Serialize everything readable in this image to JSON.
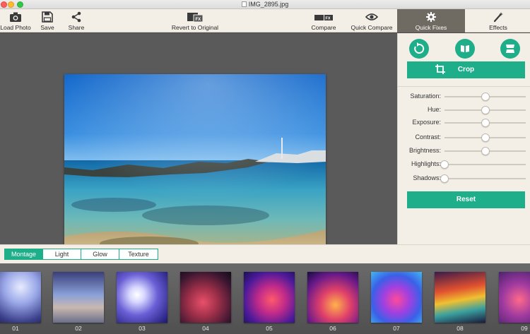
{
  "window": {
    "title": "IMG_2895.jpg"
  },
  "toolbar": {
    "load_photo": "Load Photo",
    "save": "Save",
    "share": "Share",
    "revert": "Revert to Original",
    "compare": "Compare",
    "quick_compare": "Quick Compare",
    "quick_fixes": "Quick Fixes",
    "effects": "Effects"
  },
  "panel": {
    "crop_label": "Crop",
    "sliders": [
      {
        "label": "Saturation:",
        "value": 0.5
      },
      {
        "label": "Hue:",
        "value": 0.5
      },
      {
        "label": "Exposure:",
        "value": 0.5
      },
      {
        "label": "Contrast:",
        "value": 0.5
      },
      {
        "label": "Brightness:",
        "value": 0.5
      },
      {
        "label": "Highlights:",
        "value": 0.0
      },
      {
        "label": "Shadows:",
        "value": 0.0
      }
    ],
    "reset_label": "Reset"
  },
  "tabs": [
    {
      "label": "Montage",
      "active": true
    },
    {
      "label": "Light",
      "active": false
    },
    {
      "label": "Glow",
      "active": false
    },
    {
      "label": "Texture",
      "active": false
    }
  ],
  "filmstrip": [
    {
      "label": "01"
    },
    {
      "label": "02"
    },
    {
      "label": "03"
    },
    {
      "label": "04"
    },
    {
      "label": "05"
    },
    {
      "label": "06"
    },
    {
      "label": "07"
    },
    {
      "label": "08"
    },
    {
      "label": "09"
    }
  ],
  "colors": {
    "accent": "#1fae8a",
    "active_tab_bg": "#6f6b63",
    "panel_bg": "#f3efe6"
  }
}
